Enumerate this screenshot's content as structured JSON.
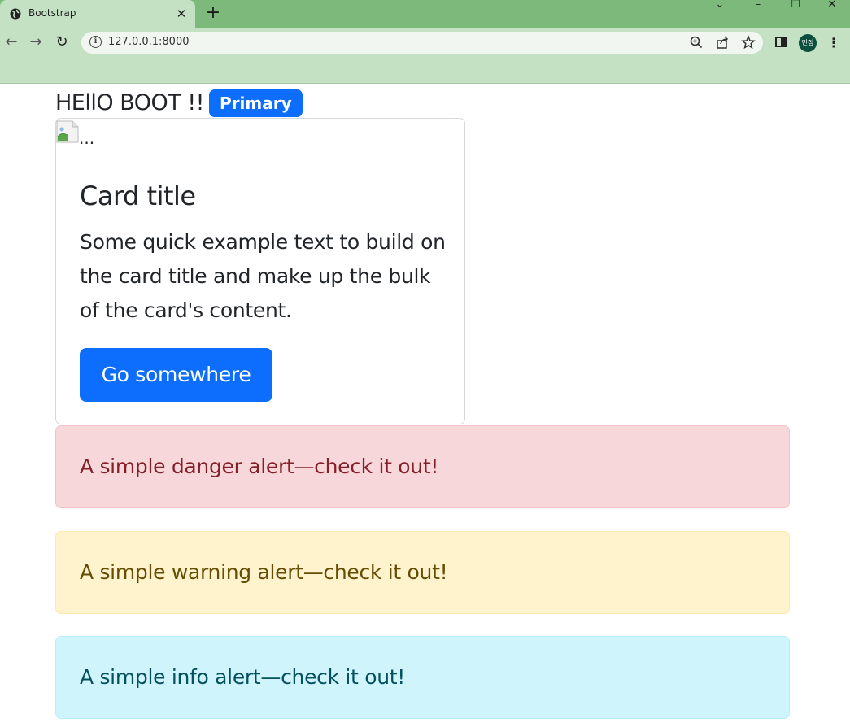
{
  "browser": {
    "tab_title": "Bootstrap",
    "tab_close": "✕",
    "new_tab": "+",
    "url": "127.0.0.1:8000",
    "avatar_text": "민정",
    "controls": {
      "dropdown": "⌄",
      "minimize": "–",
      "maximize": "☐",
      "close": "✕"
    },
    "nav": {
      "back": "←",
      "forward": "→",
      "reload": "↻"
    },
    "omni_icons": [
      "zoom-icon",
      "share-icon",
      "star-icon"
    ],
    "menu": "⋮"
  },
  "page": {
    "heading": "HEllO BOOT !!",
    "badge": "Primary",
    "card": {
      "img_alt": "...",
      "title": "Card title",
      "text": "Some quick example text to build on the card title and make up the bulk of the card's content.",
      "button": "Go somewhere"
    },
    "alerts": {
      "danger": "A simple danger alert—check it out!",
      "warning": "A simple warning alert—check it out!",
      "info": "A simple info alert—check it out!"
    }
  },
  "colors": {
    "primary": "#0d6efd",
    "danger_bg": "#f8d7da",
    "warning_bg": "#fff3cd",
    "info_bg": "#cff4fc",
    "chrome_frame": "#7db97a",
    "chrome_toolbar": "#c4e1c3"
  }
}
